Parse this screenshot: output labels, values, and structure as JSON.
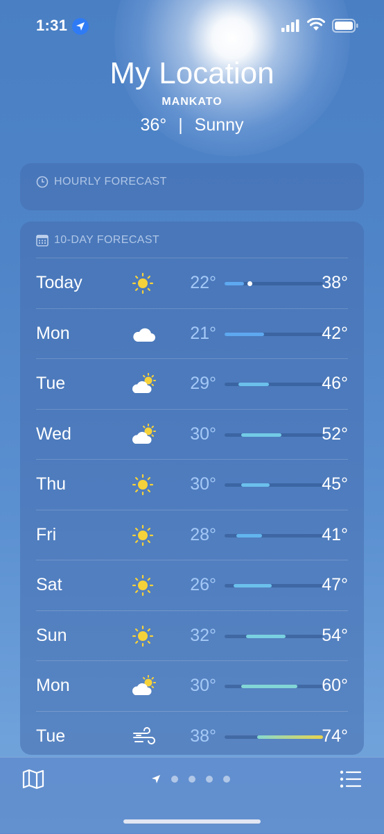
{
  "status_bar": {
    "time": "1:31"
  },
  "location": {
    "title": "My Location",
    "city": "MANKATO",
    "temperature": "36°",
    "separator": "|",
    "condition": "Sunny"
  },
  "hourly": {
    "header": "HOURLY FORECAST"
  },
  "daily": {
    "header": "10-DAY FORECAST",
    "rows": [
      {
        "day": "Today",
        "icon": "sun-icon",
        "low": "22°",
        "high": "38°",
        "bar_start": 0.0,
        "bar_end": 0.2,
        "now_marker": 0.26,
        "color": "#5ea8f0"
      },
      {
        "day": "Mon",
        "icon": "cloud-icon",
        "low": "21°",
        "high": "42°",
        "bar_start": 0.0,
        "bar_end": 0.4,
        "color": "#5ea8f0"
      },
      {
        "day": "Tue",
        "icon": "partly-cloudy-icon",
        "low": "29°",
        "high": "46°",
        "bar_start": 0.14,
        "bar_end": 0.45,
        "color": "#6bc0ec"
      },
      {
        "day": "Wed",
        "icon": "partly-cloudy-icon",
        "low": "30°",
        "high": "52°",
        "bar_start": 0.17,
        "bar_end": 0.58,
        "color": "#72cbe6"
      },
      {
        "day": "Thu",
        "icon": "sun-icon",
        "low": "30°",
        "high": "45°",
        "bar_start": 0.17,
        "bar_end": 0.46,
        "color": "#6bc0ec"
      },
      {
        "day": "Fri",
        "icon": "sun-icon",
        "low": "28°",
        "high": "41°",
        "bar_start": 0.12,
        "bar_end": 0.38,
        "color": "#62b5ee"
      },
      {
        "day": "Sat",
        "icon": "sun-icon",
        "low": "26°",
        "high": "47°",
        "bar_start": 0.09,
        "bar_end": 0.48,
        "color": "#6bc0ec"
      },
      {
        "day": "Sun",
        "icon": "sun-icon",
        "low": "32°",
        "high": "54°",
        "bar_start": 0.22,
        "bar_end": 0.62,
        "color": "#78d0e0"
      },
      {
        "day": "Mon",
        "icon": "partly-cloudy-icon",
        "low": "30°",
        "high": "60°",
        "bar_start": 0.17,
        "bar_end": 0.74,
        "color": "#82d6d6"
      },
      {
        "day": "Tue",
        "icon": "wind-icon",
        "low": "38°",
        "high": "74°",
        "bar_start": 0.33,
        "bar_end": 1.0,
        "color": "linear-gradient(90deg,#86d9d0,#e9d44c)"
      }
    ]
  },
  "toolbar": {
    "map_icon": "map-icon",
    "list_icon": "list-icon",
    "pages": 4
  },
  "colors": {
    "background": "#4f84c8",
    "accent": "#2f7bf5",
    "sun": "#f6d23a"
  }
}
